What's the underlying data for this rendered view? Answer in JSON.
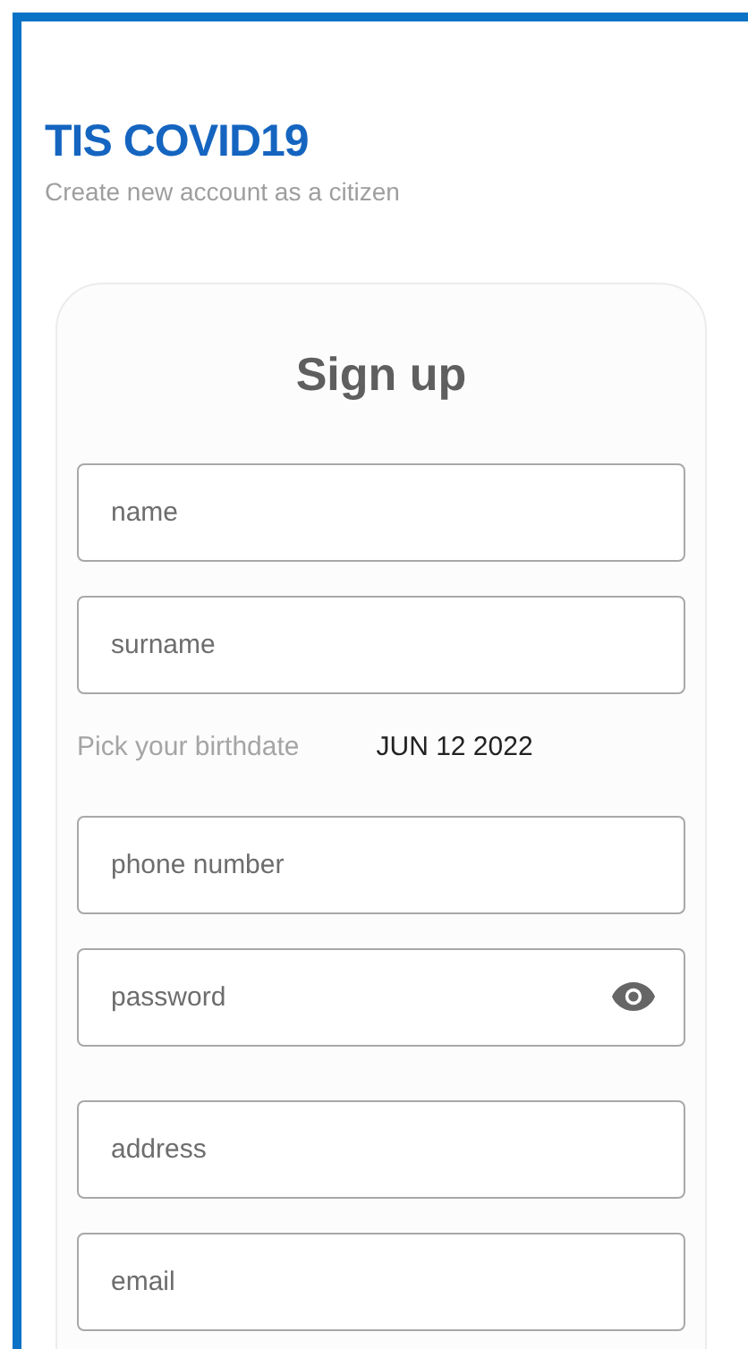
{
  "header": {
    "title": "TIS COVID19",
    "subtitle": "Create new account as a citizen"
  },
  "card": {
    "title": "Sign up",
    "fields": [
      {
        "kind": "text",
        "placeholder": "name"
      },
      {
        "kind": "text",
        "placeholder": "surname"
      },
      {
        "kind": "date",
        "label": "Pick your birthdate",
        "value": "JUN 12 2022"
      },
      {
        "kind": "text",
        "placeholder": "phone number"
      },
      {
        "kind": "password",
        "placeholder": "password"
      },
      {
        "kind": "text",
        "placeholder": "address"
      },
      {
        "kind": "text",
        "placeholder": "email"
      }
    ]
  }
}
